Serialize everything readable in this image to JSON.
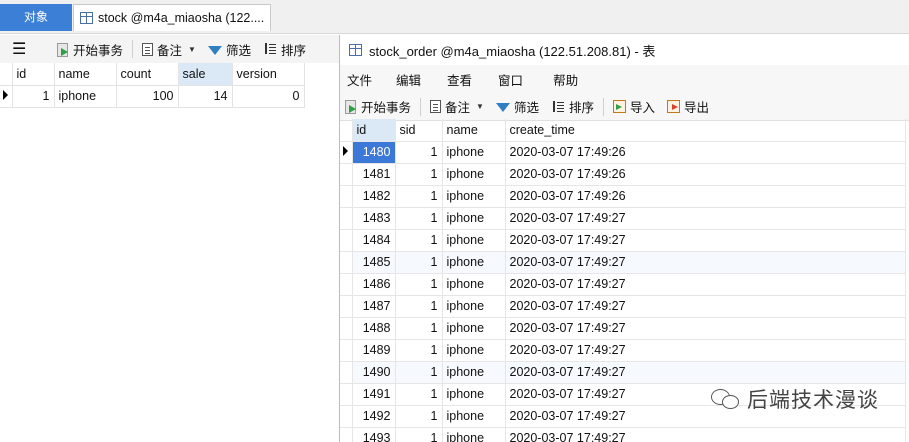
{
  "tabs": {
    "objects_label": "对象",
    "stock_tab_label": "stock @m4a_miaosha (122...."
  },
  "bg_toolbar": {
    "begin_tx": "开始事务",
    "note": "备注",
    "filter": "筛选",
    "sort": "排序"
  },
  "bg_table": {
    "columns": [
      "id",
      "name",
      "count",
      "sale",
      "version"
    ],
    "selected_column": "sale",
    "rows": [
      {
        "id": "1",
        "name": "iphone",
        "count": "100",
        "sale": "14",
        "version": "0"
      }
    ]
  },
  "fg_window": {
    "title": "stock_order @m4a_miaosha (122.51.208.81) - 表",
    "menu": [
      "文件",
      "编辑",
      "查看",
      "窗口",
      "帮助"
    ],
    "toolbar": {
      "begin_tx": "开始事务",
      "note": "备注",
      "filter": "筛选",
      "sort": "排序",
      "import": "导入",
      "export": "导出"
    },
    "columns": [
      "id",
      "sid",
      "name",
      "create_time"
    ],
    "selected_column": "id",
    "rows": [
      {
        "id": "1480",
        "sid": "1",
        "name": "iphone",
        "create_time": "2020-03-07 17:49:26"
      },
      {
        "id": "1481",
        "sid": "1",
        "name": "iphone",
        "create_time": "2020-03-07 17:49:26"
      },
      {
        "id": "1482",
        "sid": "1",
        "name": "iphone",
        "create_time": "2020-03-07 17:49:26"
      },
      {
        "id": "1483",
        "sid": "1",
        "name": "iphone",
        "create_time": "2020-03-07 17:49:27"
      },
      {
        "id": "1484",
        "sid": "1",
        "name": "iphone",
        "create_time": "2020-03-07 17:49:27"
      },
      {
        "id": "1485",
        "sid": "1",
        "name": "iphone",
        "create_time": "2020-03-07 17:49:27"
      },
      {
        "id": "1486",
        "sid": "1",
        "name": "iphone",
        "create_time": "2020-03-07 17:49:27"
      },
      {
        "id": "1487",
        "sid": "1",
        "name": "iphone",
        "create_time": "2020-03-07 17:49:27"
      },
      {
        "id": "1488",
        "sid": "1",
        "name": "iphone",
        "create_time": "2020-03-07 17:49:27"
      },
      {
        "id": "1489",
        "sid": "1",
        "name": "iphone",
        "create_time": "2020-03-07 17:49:27"
      },
      {
        "id": "1490",
        "sid": "1",
        "name": "iphone",
        "create_time": "2020-03-07 17:49:27"
      },
      {
        "id": "1491",
        "sid": "1",
        "name": "iphone",
        "create_time": "2020-03-07 17:49:27"
      },
      {
        "id": "1492",
        "sid": "1",
        "name": "iphone",
        "create_time": "2020-03-07 17:49:27"
      },
      {
        "id": "1493",
        "sid": "1",
        "name": "iphone",
        "create_time": "2020-03-07 17:49:27"
      }
    ]
  },
  "watermark": "后端技术漫谈",
  "colors": {
    "tab_active": "#3c7fd6",
    "selected_cell": "#3b78d8",
    "selected_header": "#dbe9f7"
  }
}
